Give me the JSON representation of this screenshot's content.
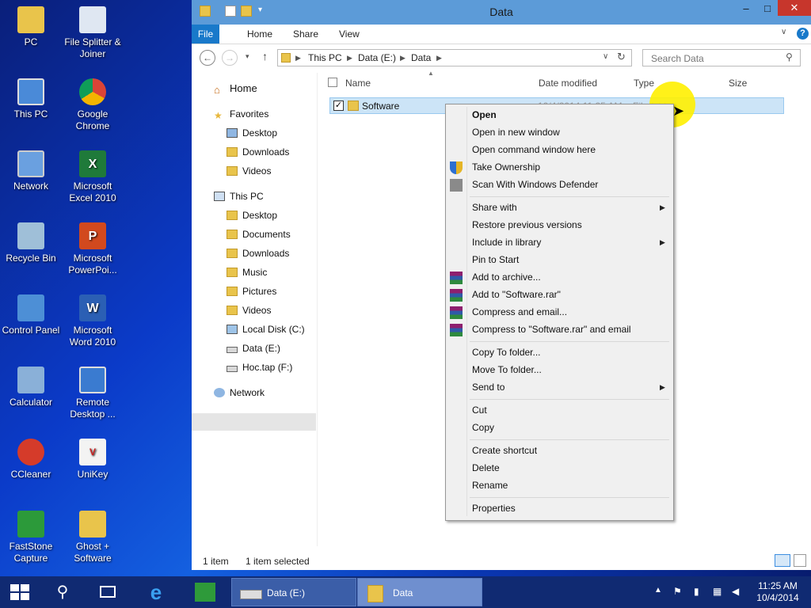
{
  "desktop": {
    "icons": [
      {
        "label": "PC",
        "icon": "folder-user-icon"
      },
      {
        "label": "File Splitter & Joiner",
        "icon": "file-splitter-icon"
      },
      {
        "label": "This PC",
        "icon": "computer-icon"
      },
      {
        "label": "Google Chrome",
        "icon": "chrome-icon"
      },
      {
        "label": "Network",
        "icon": "network-icon"
      },
      {
        "label": "Microsoft Excel 2010",
        "icon": "excel-icon"
      },
      {
        "label": "Recycle Bin",
        "icon": "recycle-bin-icon"
      },
      {
        "label": "Microsoft PowerPoi...",
        "icon": "powerpoint-icon"
      },
      {
        "label": "Control Panel",
        "icon": "control-panel-icon"
      },
      {
        "label": "Microsoft Word 2010",
        "icon": "word-icon"
      },
      {
        "label": "Calculator",
        "icon": "calculator-icon"
      },
      {
        "label": "Remote Desktop ...",
        "icon": "remote-desktop-icon"
      },
      {
        "label": "CCleaner",
        "icon": "ccleaner-icon"
      },
      {
        "label": "UniKey",
        "icon": "unikey-icon"
      },
      {
        "label": "FastStone Capture",
        "icon": "faststone-icon"
      },
      {
        "label": "Ghost + Software",
        "icon": "folder-icon"
      }
    ]
  },
  "window": {
    "title": "Data",
    "controls": {
      "minimize": "–",
      "maximize": "□",
      "close": "✕"
    },
    "ribbon_tabs": [
      "File",
      "Home",
      "Share",
      "View"
    ],
    "help": "?",
    "address": {
      "segments": [
        "This PC",
        "Data (E:)",
        "Data"
      ]
    },
    "search": {
      "placeholder": "Search Data"
    },
    "nav": {
      "home": "Home",
      "favorites": "Favorites",
      "fav_items": [
        "Desktop",
        "Downloads",
        "Videos"
      ],
      "this_pc": "This PC",
      "pc_items": [
        "Desktop",
        "Documents",
        "Downloads",
        "Music",
        "Pictures",
        "Videos",
        "Local Disk (C:)",
        "Data (E:)",
        "Hoc.tap (F:)"
      ],
      "network": "Network",
      "selected": "Data (E:)"
    },
    "columns": [
      "Name",
      "Date modified",
      "Type",
      "Size"
    ],
    "files": [
      {
        "name": "Software",
        "date": "10/4/2014 11:25 AM",
        "type": "File folder",
        "selected": true
      }
    ],
    "status": {
      "count": "1 item",
      "selected": "1 item selected"
    }
  },
  "context_menu": {
    "groups": [
      [
        {
          "label": "Open",
          "bold": true
        },
        {
          "label": "Open in new window"
        },
        {
          "label": "Open command window here"
        },
        {
          "label": "Take Ownership",
          "icon": "shield-icon"
        },
        {
          "label": "Scan With Windows Defender",
          "icon": "defender-icon"
        }
      ],
      [
        {
          "label": "Share with",
          "submenu": true
        },
        {
          "label": "Restore previous versions"
        },
        {
          "label": "Include in library",
          "submenu": true
        },
        {
          "label": "Pin to Start"
        },
        {
          "label": "Add to archive...",
          "icon": "winrar-icon"
        },
        {
          "label": "Add to \"Software.rar\"",
          "icon": "winrar-icon"
        },
        {
          "label": "Compress and email...",
          "icon": "winrar-icon"
        },
        {
          "label": "Compress to \"Software.rar\" and email",
          "icon": "winrar-icon"
        }
      ],
      [
        {
          "label": "Copy To folder..."
        },
        {
          "label": "Move To folder..."
        },
        {
          "label": "Send to",
          "submenu": true
        }
      ],
      [
        {
          "label": "Cut"
        },
        {
          "label": "Copy"
        }
      ],
      [
        {
          "label": "Create shortcut"
        },
        {
          "label": "Delete"
        },
        {
          "label": "Rename"
        }
      ],
      [
        {
          "label": "Properties"
        }
      ]
    ]
  },
  "taskbar": {
    "apps": [
      {
        "label": "Data (E:)",
        "icon": "drive-icon"
      },
      {
        "label": "Data",
        "icon": "folder-icon"
      }
    ],
    "clock": {
      "time": "11:25 AM",
      "date": "10/4/2014"
    }
  },
  "colors": {
    "title_bar": "#5c9bd8",
    "file_tab": "#1979ca",
    "selection": "#cce4f7",
    "taskbar": "#102a72"
  }
}
